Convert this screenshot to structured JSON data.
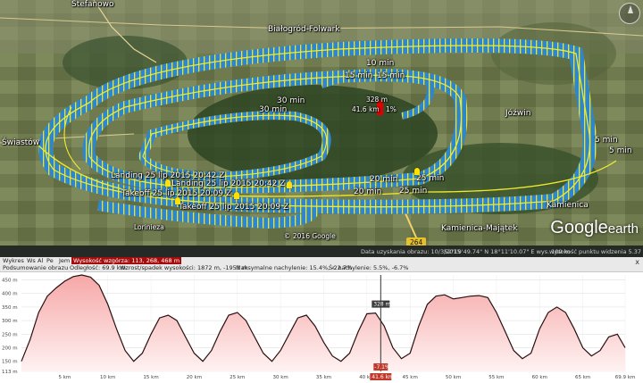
{
  "map": {
    "places": [
      {
        "name": "Stefanowo"
      },
      {
        "name": "Białogród-Folwark"
      },
      {
        "name": "Świastów"
      },
      {
        "name": "Jóźwin"
      },
      {
        "name": "Kamienica-Majątek"
      },
      {
        "name": "Kamienica"
      },
      {
        "name": "Lorinieza"
      }
    ],
    "time_markers": [
      "10 min",
      "15 min",
      "15 min",
      "30 min",
      "30 min",
      "5 min",
      "5 min",
      "20 min",
      "20 min",
      "25 min",
      "25 min"
    ],
    "flight_labels": [
      "Landing  25 lip 2015 20:42 Z",
      "Landing  25 lip 2015 20:42 Z",
      "Takeoff  25 lip 2015 20:09 Z",
      "Takeoff  25 lip 2015 20:09 Z"
    ],
    "cursor_alt": "328 m",
    "cursor_dist": "41.6 km",
    "cursor_pct": "1%",
    "road": "264",
    "copyright": "© 2016 Google",
    "brand": "Google",
    "brand2": "earth"
  },
  "status": {
    "imagery_date": "Data uzyskania obrazu: 10/3/2015",
    "coords": "52°19'49.74\" N   18°11'10.07\" E   wys.  109 m",
    "eye_alt": "wysokość punktu widzenia  5.37 km"
  },
  "elevation_profile": {
    "toolbar": {
      "profile_label": "Wykres",
      "all_label": "Ws",
      "al_label": "Al",
      "pe_label": "Pe",
      "units_label": "Jem",
      "range_highlight": "Wysokość wzgórza: 113, 268, 468 m",
      "row2_a": "Podsumowanie obrazu",
      "row2_b": "Odległość: 69.9 km",
      "row2_c": "Wzrost/spadek wysokości: 1872 m, -1951 m",
      "row2_d": "Maksymalne nachylenie: 15.4%, -22.7%",
      "row2_e": "Śr. nachylenie: 5.5%, -6.7%",
      "close": "x"
    },
    "y_ticks": [
      "450 m",
      "400 m",
      "350 m",
      "300 m",
      "250 m",
      "200 m",
      "150 m",
      "113 m"
    ],
    "x_ticks": [
      "5 km",
      "10 km",
      "15 km",
      "20 km",
      "25 km",
      "30 km",
      "35 km",
      "40 km",
      "45 km",
      "50 km",
      "55 km",
      "60 km",
      "65 km",
      "69.9 km"
    ],
    "cursor": {
      "alt": "328 m",
      "dist": "41.6 km",
      "slope": "-7.1%"
    }
  },
  "chart_data": {
    "type": "area",
    "xlabel": "",
    "ylabel": "",
    "xlim": [
      0,
      69.9
    ],
    "ylim": [
      113,
      468
    ],
    "x": [
      0,
      1,
      2,
      3,
      4,
      5,
      6,
      7,
      8,
      9,
      10,
      11,
      12,
      13,
      14,
      15,
      16,
      17,
      18,
      19,
      20,
      21,
      22,
      23,
      24,
      25,
      26,
      27,
      28,
      29,
      30,
      31,
      32,
      33,
      34,
      35,
      36,
      37,
      38,
      39,
      40,
      41,
      42,
      43,
      44,
      45,
      46,
      47,
      48,
      49,
      50,
      51,
      52,
      53,
      54,
      55,
      56,
      57,
      58,
      59,
      60,
      61,
      62,
      63,
      64,
      65,
      66,
      67,
      68,
      69,
      69.9
    ],
    "y": [
      150,
      230,
      330,
      390,
      420,
      445,
      462,
      468,
      460,
      430,
      360,
      270,
      190,
      150,
      180,
      250,
      310,
      320,
      300,
      240,
      180,
      150,
      190,
      260,
      320,
      330,
      300,
      240,
      180,
      150,
      190,
      250,
      310,
      320,
      280,
      220,
      170,
      150,
      180,
      260,
      325,
      328,
      280,
      200,
      160,
      180,
      280,
      360,
      390,
      395,
      380,
      385,
      390,
      392,
      385,
      330,
      260,
      190,
      160,
      180,
      270,
      330,
      350,
      330,
      270,
      200,
      170,
      190,
      240,
      250,
      200
    ],
    "grid": true,
    "color": "#e94b4b"
  }
}
